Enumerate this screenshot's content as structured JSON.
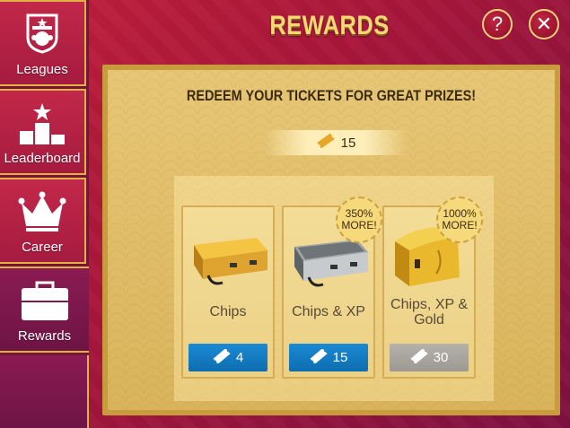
{
  "sidebar": {
    "items": [
      {
        "label": "Leagues",
        "icon": "league-crest-icon"
      },
      {
        "label": "Leaderboard",
        "icon": "podium-icon"
      },
      {
        "label": "Career",
        "icon": "crown-icon"
      },
      {
        "label": "Rewards",
        "icon": "briefcase-icon",
        "active": true
      }
    ]
  },
  "header": {
    "title": "REWARDS",
    "help_label": "?",
    "close_label": "✕"
  },
  "panel": {
    "heading": "REDEEM YOUR TICKETS FOR GREAT PRIZES!",
    "ticket_count": "15",
    "ticket_icon": "ticket-icon"
  },
  "rewards": [
    {
      "label": "Chips",
      "cost": "4",
      "icon": "gold-briefcase-icon",
      "available": true
    },
    {
      "label": "Chips & XP",
      "cost": "15",
      "icon": "silver-briefcase-icon",
      "badge": [
        "350%",
        "MORE!"
      ],
      "available": true
    },
    {
      "label": "Chips, XP & Gold",
      "cost": "30",
      "icon": "gold-chest-icon",
      "badge": [
        "1000%",
        "MORE!"
      ],
      "available": false
    }
  ],
  "colors": {
    "accent_gold": "#e0b246",
    "title_gold": "#f7d774",
    "button_blue": "#1a8ad4",
    "button_grey": "#a8a69f",
    "background_red": "#a8163a"
  }
}
